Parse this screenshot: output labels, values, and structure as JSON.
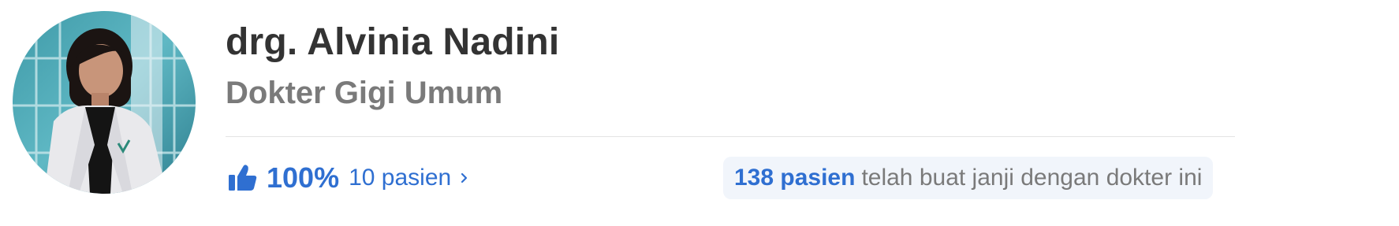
{
  "doctor": {
    "name": "drg. Alvinia Nadini",
    "specialty": "Dokter Gigi Umum"
  },
  "rating": {
    "icon": "thumbs-up-icon",
    "percentage": "100%",
    "patients": "10 pasien",
    "percent_value": 100
  },
  "booking": {
    "count": "138 pasien",
    "text": "telah buat janji dengan dokter ini"
  },
  "colors": {
    "accent": "#2f6fd1",
    "name": "#333333",
    "muted": "#7a7a7a",
    "badge_bg": "#f1f5fb"
  }
}
